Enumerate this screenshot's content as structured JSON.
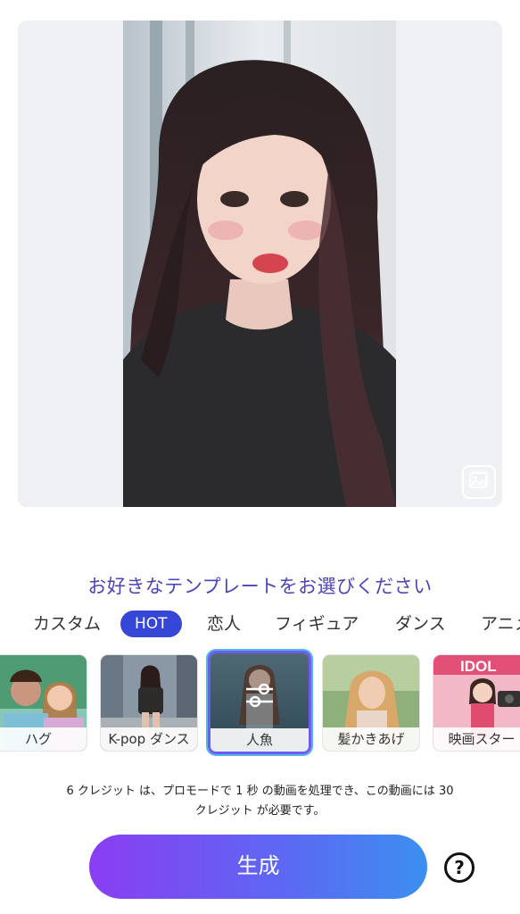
{
  "preview": {
    "gallery_icon": "image-gallery-icon"
  },
  "prompt": "お好きなテンプレートをお選びください",
  "tabs": [
    {
      "label": "カスタム",
      "active": false
    },
    {
      "label": "HOT",
      "active": true
    },
    {
      "label": "恋人",
      "active": false
    },
    {
      "label": "フィギュア",
      "active": false
    },
    {
      "label": "ダンス",
      "active": false
    },
    {
      "label": "アニメ",
      "active": false
    }
  ],
  "templates": [
    {
      "label": "ハグ",
      "selected": false
    },
    {
      "label": "K-pop ダンス",
      "selected": false
    },
    {
      "label": "人魚",
      "selected": true
    },
    {
      "label": "髪かきあげ",
      "selected": false
    },
    {
      "label": "映画スター",
      "selected": false
    }
  ],
  "idol_sign": "IDOL",
  "info_line1": "6 クレジット は、プロモードで 1 秒 の動画を処理でき、この動画には 30",
  "info_line2": "クレジット が必要です。",
  "generate_label": "生成",
  "help_label": "?",
  "colors": {
    "accent": "#3646d6",
    "prompt_text": "#4a45b8",
    "selected_border": "#6b5cf2",
    "button_gradient_start": "#8a3df2",
    "button_gradient_end": "#3c8ff0"
  }
}
